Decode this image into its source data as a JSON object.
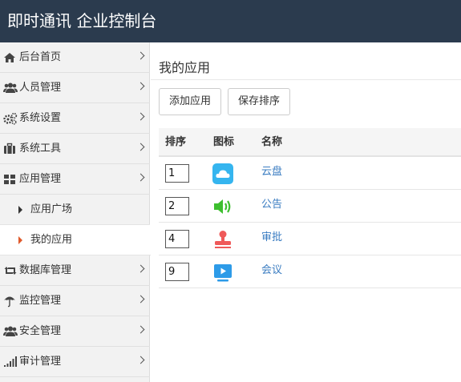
{
  "header": {
    "title": "即时通讯 企业控制台"
  },
  "sidebar": {
    "items": [
      {
        "label": "后台首页",
        "icon": "home-icon"
      },
      {
        "label": "人员管理",
        "icon": "users-icon"
      },
      {
        "label": "系统设置",
        "icon": "gears-icon"
      },
      {
        "label": "系统工具",
        "icon": "briefcase-icon"
      },
      {
        "label": "应用管理",
        "icon": "grid-icon"
      },
      {
        "label": "数据库管理",
        "icon": "retweet-icon"
      },
      {
        "label": "监控管理",
        "icon": "umbrella-icon"
      },
      {
        "label": "安全管理",
        "icon": "users-icon"
      },
      {
        "label": "审计管理",
        "icon": "signal-icon"
      }
    ],
    "subitems": [
      {
        "label": "应用广场",
        "active": false
      },
      {
        "label": "我的应用",
        "active": true
      }
    ]
  },
  "main": {
    "title": "我的应用",
    "buttons": {
      "add": "添加应用",
      "save_order": "保存排序"
    },
    "table": {
      "headers": [
        "排序",
        "图标",
        "名称"
      ],
      "rows": [
        {
          "order": "1",
          "icon": "cloud-icon",
          "name": "云盘",
          "color": "#35b5ef"
        },
        {
          "order": "2",
          "icon": "speaker-icon",
          "name": "公告",
          "color": "#3dbf2f"
        },
        {
          "order": "4",
          "icon": "stamp-icon",
          "name": "审批",
          "color": "#ef5a5a"
        },
        {
          "order": "9",
          "icon": "play-icon",
          "name": "会议",
          "color": "#2d9be8"
        }
      ]
    }
  },
  "colors": {
    "header_bg": "#2b3b4e",
    "link": "#3a7cc1",
    "active_marker": "#e05a2b"
  }
}
